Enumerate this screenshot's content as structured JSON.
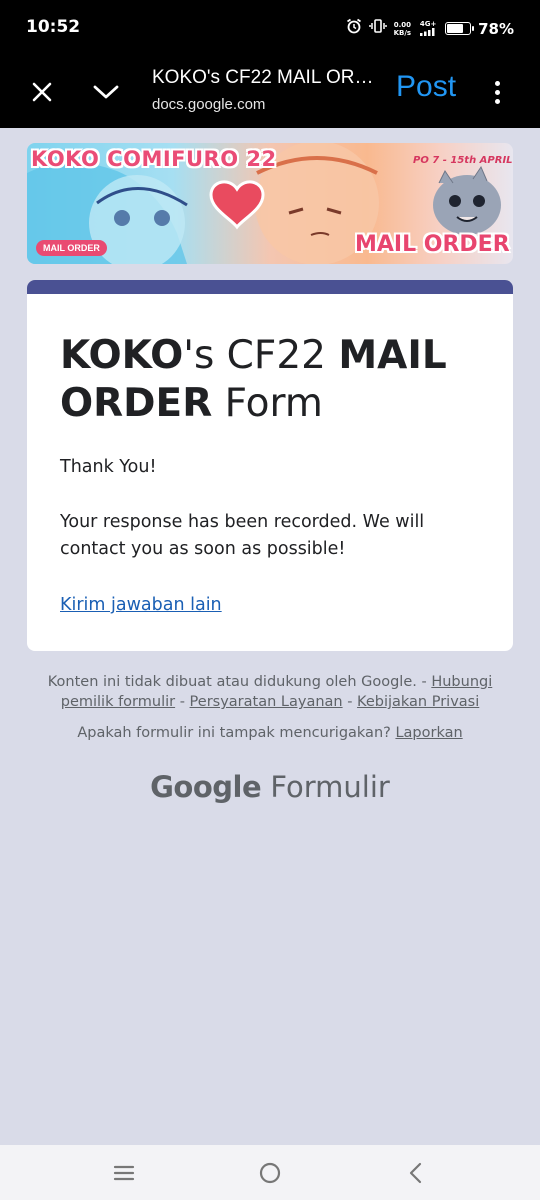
{
  "status_bar": {
    "time": "10:52",
    "net_speed_value": "0.00",
    "net_speed_unit": "KB/s",
    "network_type": "4G+",
    "battery_percent": "78%",
    "battery_level": 0.78
  },
  "app_bar": {
    "title": "KOKO's CF22 MAIL ORDER Form",
    "url": "docs.google.com",
    "post_label": "Post"
  },
  "banner": {
    "title": "KOKO COMIFURO 22",
    "badge": "MAIL ORDER",
    "po_dates": "PO 7 - 15th APRIL",
    "mail_order": "MAIL ORDER"
  },
  "form": {
    "title_part1": "KOKO",
    "title_part2": "'s CF22 ",
    "title_part3": "MAIL ORDER",
    "title_part4": " Form",
    "thank_you": "Thank You!",
    "response_message": "Your response has been recorded. We will contact you as soon as possible!",
    "resubmit_link": "Kirim jawaban lain",
    "accent_color": "#4a5193"
  },
  "footer": {
    "disclaimer": "Konten ini tidak dibuat atau didukung oleh Google. - ",
    "contact_owner": "Hubungi pemilik formulir",
    "sep1": " - ",
    "terms": "Persyaratan Layanan",
    "sep2": " - ",
    "privacy": "Kebijakan Privasi",
    "suspicious": "Apakah formulir ini tampak mencurigakan? ",
    "report": "Laporkan",
    "brand_google": "Google",
    "brand_product": "Formulir"
  },
  "nav": {
    "recents_icon": "menu-icon",
    "home_icon": "circle-home-icon",
    "back_icon": "back-chevron-icon"
  }
}
